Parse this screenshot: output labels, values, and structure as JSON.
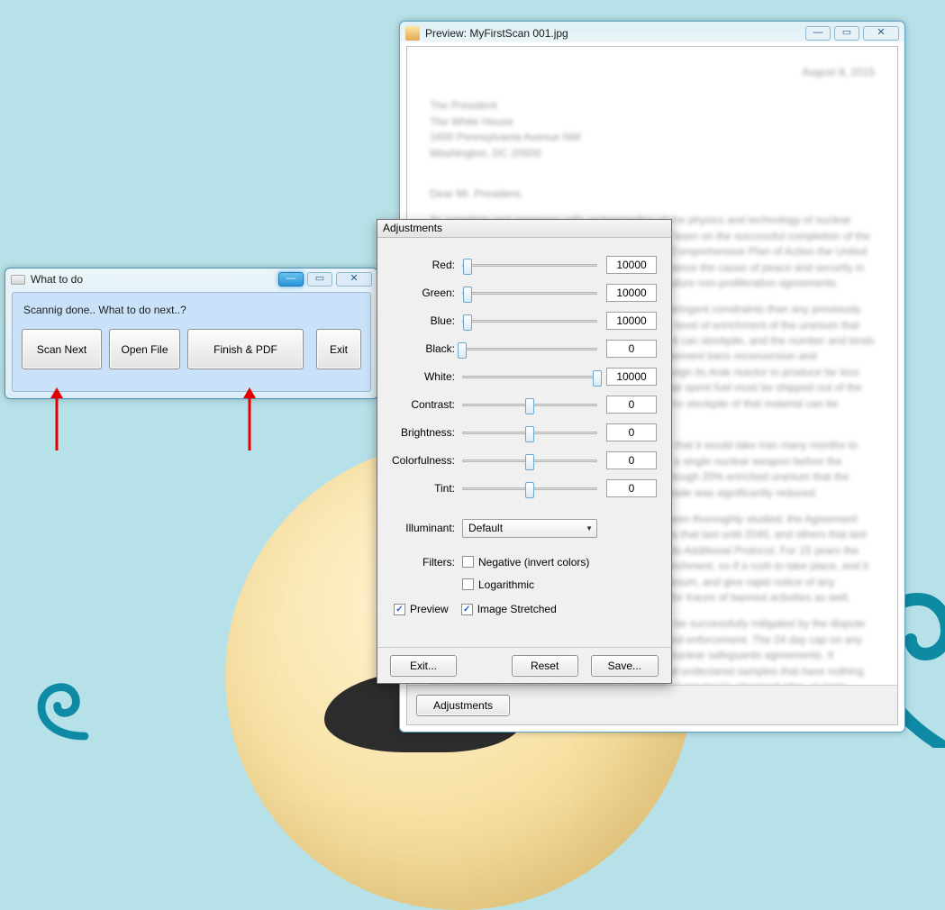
{
  "preview": {
    "title": "Preview: MyFirstScan 001.jpg",
    "adjustments_button": "Adjustments",
    "doc": {
      "date": "August 8, 2015",
      "addr1": "The President",
      "addr2": "The White House",
      "addr3": "1600 Pennsylvania Avenue NW",
      "addr4": "Washington, DC 20500",
      "salutation": "Dear Mr. President,",
      "p1": "As scientists and engineers with understanding of the physics and technology of nuclear power and weapons we congratulate you and your team on the successful completion of the negotiations in Vienna. We consider that the Joint Comprehensive Plan of Action the United States and its partners negotiated with Iran will advance the cause of peace and security in the Middle East and can serve as a guidepost for future non-proliferation agreements.",
      "p2": "This is an innovative agreement, with much more stringent constraints than any previously negotiated non-proliferation framework. It limits the level of enrichment of the uranium that Iran can produce, the amount of enriched uranium it can stockpile, and the number and kinds of centrifuges it can develop and operate. The agreement bans reconversion and reprocessing of reactor fuel, it requires Iran to redesign its Arak reactor to produce far less plutonium than the original design, and specifies that spent fuel must be shipped out of the country without the plutonium being separated, so no stockpile of that material can be accumulated.",
      "p3": "A concern some have raised with the agreement is that it would take Iran many months to enrich enough uranium to weapons grade to make a single nuclear weapon before the interim agreement began. Iran had accumulated enough 20% enriched uranium that the required additional enrichment time for weapons-grade was significantly reduced.",
      "p4": "We are confident that the technical aspects have been thoroughly studied; the Agreement includes important long-term verification procedures that last until 2040, and others that last indefinitely under the Non-Proliferation Treaty and its Additional Protocol. For 15 years the Atomic facility will be limited to 300 kg of 3.67% enrichment, so if a rush to take place, and it would take Iran many months to enrich enough uranium, and give rapid notice of any violation, so inspectors could re-inspect at Natanz for traces of banned activities as well.",
      "p5": "We also note that the agreement is strong and can be successfully mitigated by the dispute resolution mechanisms built into it for verification and enforcement. The 24 day cap on any delay to access is unprecedented in the history of nuclear safeguards agreements. It challenges inspection for the detection of suspected undeclared samples that have nothing like enrichment, construction of related equipment at previously observed sites, or tests using uranium. The agreement includes provisions that if it is violated, which would claim it is innovative as well. We understand that some in Congress will be satisfied that it is a fully."
    }
  },
  "adjustments": {
    "title": "Adjustments",
    "sliders": [
      {
        "label": "Red:",
        "value": "10000",
        "pos": 4
      },
      {
        "label": "Green:",
        "value": "10000",
        "pos": 4
      },
      {
        "label": "Blue:",
        "value": "10000",
        "pos": 4
      },
      {
        "label": "Black:",
        "value": "0",
        "pos": 0
      },
      {
        "label": "White:",
        "value": "10000",
        "pos": 100
      },
      {
        "label": "Contrast:",
        "value": "0",
        "pos": 50
      },
      {
        "label": "Brightness:",
        "value": "0",
        "pos": 50
      },
      {
        "label": "Colorfulness:",
        "value": "0",
        "pos": 50
      },
      {
        "label": "Tint:",
        "value": "0",
        "pos": 50
      }
    ],
    "illuminant_label": "Illuminant:",
    "illuminant_value": "Default",
    "filters_label": "Filters:",
    "filter_negative": "Negative (invert colors)",
    "filter_log": "Logarithmic",
    "preview_chk": "Preview",
    "stretched_chk": "Image Stretched",
    "exit": "Exit...",
    "reset": "Reset",
    "save": "Save..."
  },
  "wtd": {
    "title": "What to do",
    "msg": "Scannig done.. What to do next..?",
    "scan_next": "Scan Next",
    "open_file": "Open File",
    "finish_pdf": "Finish & PDF",
    "exit": "Exit"
  }
}
